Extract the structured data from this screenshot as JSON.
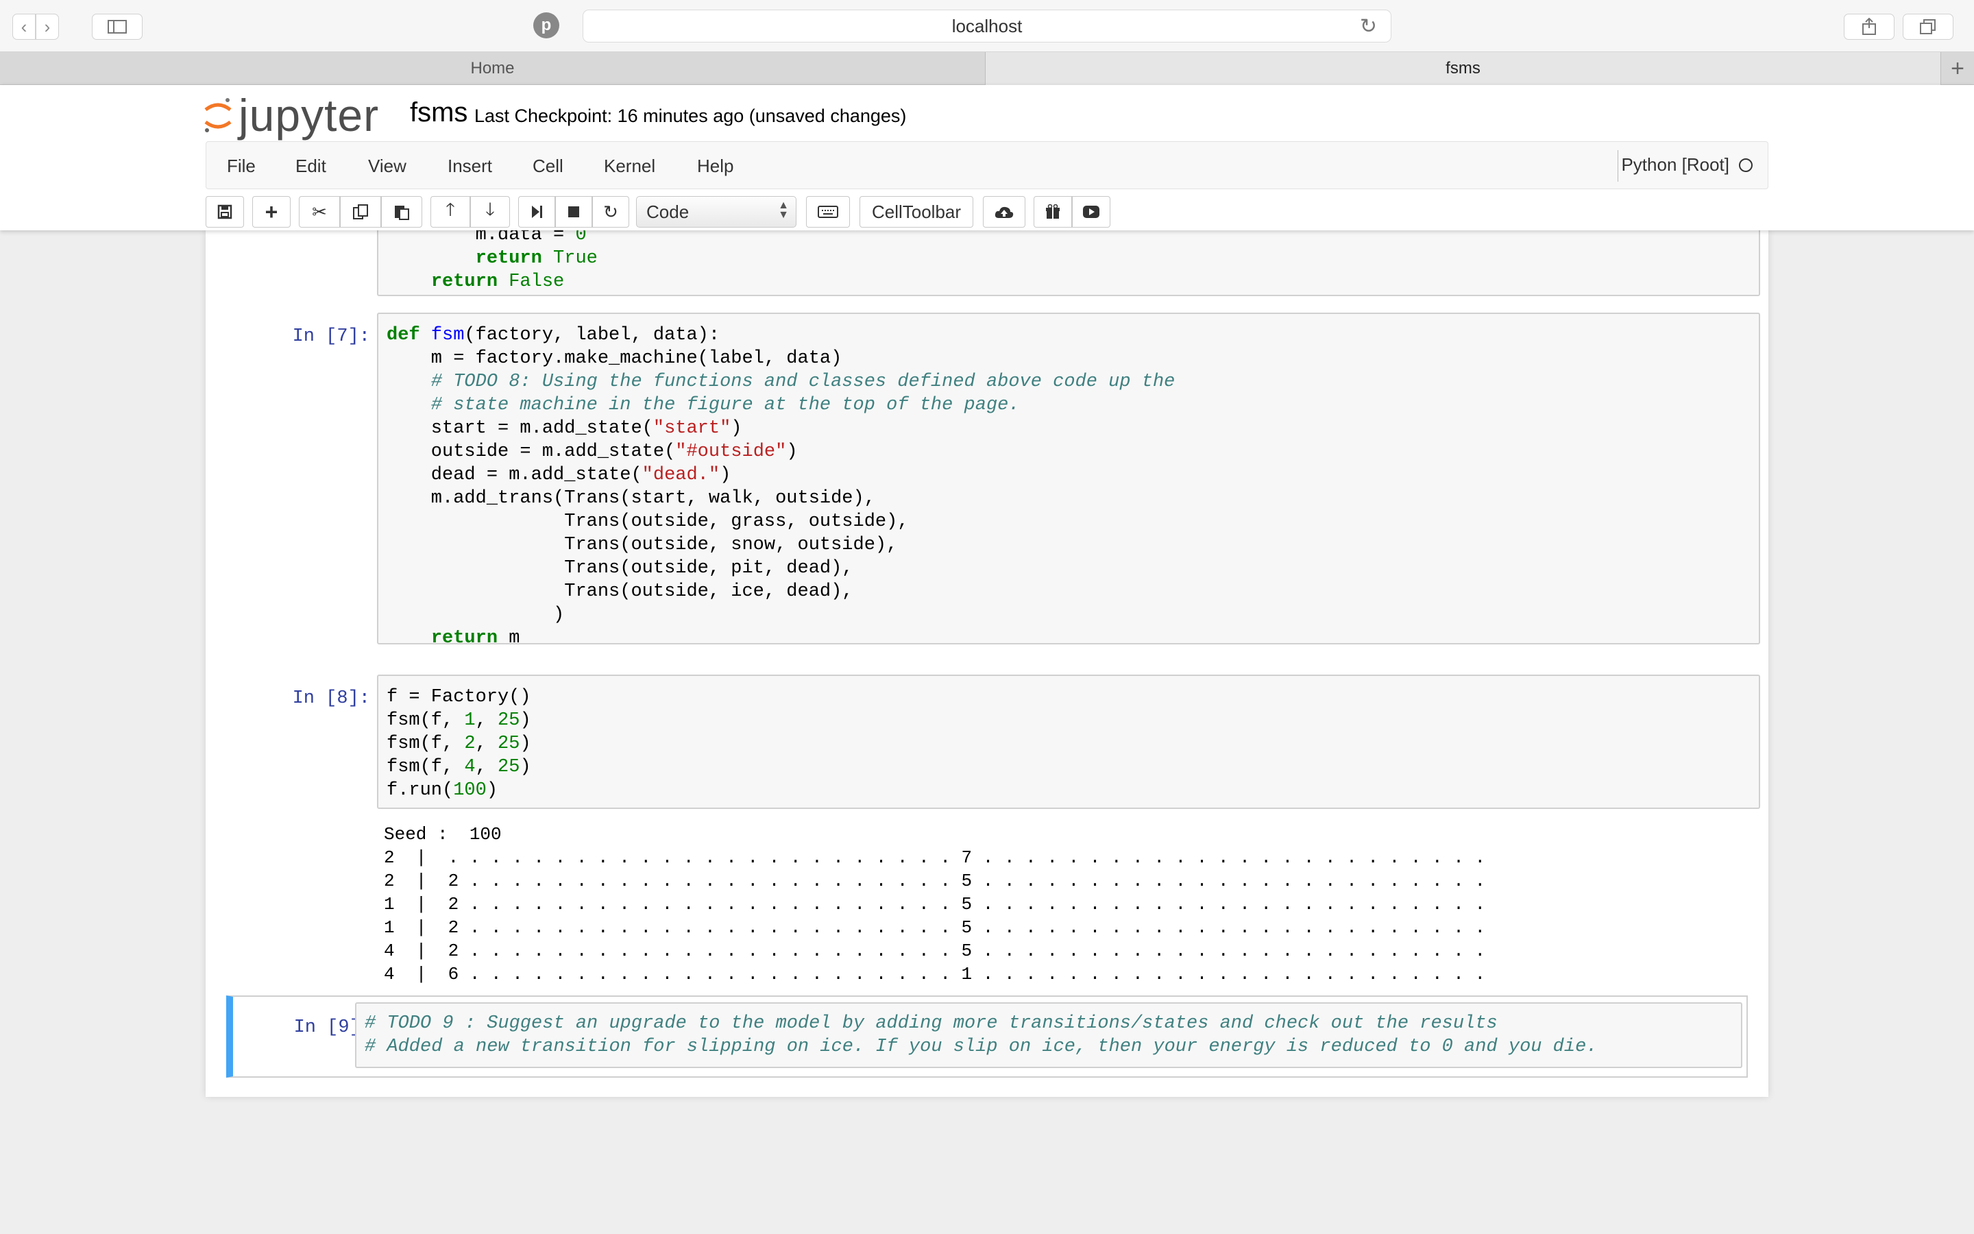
{
  "browser": {
    "url": "localhost",
    "tabs": [
      {
        "label": "Home",
        "active": false
      },
      {
        "label": "fsms",
        "active": true
      }
    ]
  },
  "header": {
    "logo_text": "jupyter",
    "notebook_name": "fsms",
    "checkpoint": "Last Checkpoint: 16 minutes ago (unsaved changes)"
  },
  "menu": {
    "items": [
      "File",
      "Edit",
      "View",
      "Insert",
      "Cell",
      "Kernel",
      "Help"
    ],
    "kernel_name": "Python [Root]"
  },
  "toolbar": {
    "cell_type": "Code",
    "celltoolbar_label": "CellToolbar",
    "icons": [
      "save-icon",
      "add-cell-icon",
      "cut-icon",
      "copy-icon",
      "paste-icon",
      "move-up-icon",
      "move-down-icon",
      "run-icon",
      "stop-icon",
      "restart-icon",
      "keyboard-icon",
      "cloud-upload-icon",
      "gift-icon",
      "youtube-icon"
    ]
  },
  "cells": {
    "partial_top_lines": [
      "        m.data = 0",
      "        return True",
      "    return False"
    ],
    "cell7": {
      "prompt": "In [7]:",
      "code": "def fsm(factory, label, data):\n    m = factory.make_machine(label, data)\n    # TODO 8: Using the functions and classes defined above code up the\n    # state machine in the figure at the top of the page.\n    start = m.add_state(\"start\")\n    outside = m.add_state(\"#outside\")\n    dead = m.add_state(\"dead.\")\n    m.add_trans(Trans(start, walk, outside),\n                Trans(outside, grass, outside),\n                Trans(outside, snow, outside),\n                Trans(outside, pit, dead),\n                Trans(outside, ice, dead),\n               )\n    return m"
    },
    "cell8": {
      "prompt": "In [8]:",
      "code": "f = Factory()\nfsm(f, 1, 25)\nfsm(f, 2, 25)\nfsm(f, 4, 25)\nf.run(100)",
      "output": "Seed :  100\n2  |  . . . . . . . . . . . . . . . . . . . . . . . . 7 . . . . . . . . . . . . . . . . . . . . . . . .\n2  |  2 . . . . . . . . . . . . . . . . . . . . . . . 5 . . . . . . . . . . . . . . . . . . . . . . . .\n1  |  2 . . . . . . . . . . . . . . . . . . . . . . . 5 . . . . . . . . . . . . . . . . . . . . . . . .\n1  |  2 . . . . . . . . . . . . . . . . . . . . . . . 5 . . . . . . . . . . . . . . . . . . . . . . . .\n4  |  2 . . . . . . . . . . . . . . . . . . . . . . . 5 . . . . . . . . . . . . . . . . . . . . . . . .\n4  |  6 . . . . . . . . . . . . . . . . . . . . . . . 1 . . . . . . . . . . . . . . . . . . . . . . . ."
    },
    "cell9": {
      "prompt": "In [9]:",
      "code": "# TODO 9 : Suggest an upgrade to the model by adding more transitions/states and check out the results\n# Added a new transition for slipping on ice. If you slip on ice, then your energy is reduced to 0 and you die."
    }
  }
}
